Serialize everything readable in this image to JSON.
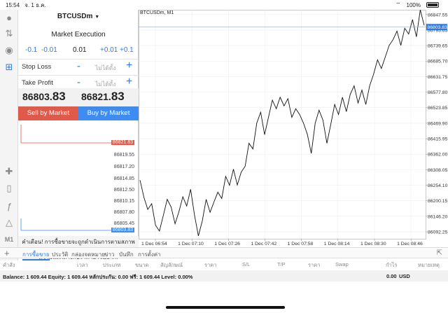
{
  "status_bar": {
    "time": "15:54",
    "date": "จ. 1 ธ.ค.",
    "battery": "100%"
  },
  "order": {
    "symbol": "BTCUSDm",
    "execution": "Market Execution",
    "volume": {
      "minus_01": "-0.1",
      "minus_001": "-0.01",
      "value": "0.01",
      "plus_001": "+0.01",
      "plus_01": "+0.1"
    },
    "stop_loss": {
      "label": "Stop Loss",
      "placeholder": "ไม่ได้ตั้ง",
      "minus": "-",
      "plus": "+"
    },
    "take_profit": {
      "label": "Take Profit",
      "placeholder": "ไม่ได้ตั้ง",
      "minus": "-",
      "plus": "+"
    },
    "sell_price": {
      "head": "86803.",
      "tail": "83"
    },
    "buy_price": {
      "head": "86821.",
      "tail": "83"
    },
    "sell_label": "Sell by Market",
    "buy_label": "Buy by Market",
    "ladder": {
      "ask_tag": "86821.83",
      "bid_tag": "86803.83",
      "ticks": [
        "86819.55",
        "86817.20",
        "86814.85",
        "86812.50",
        "86810.15",
        "86807.80",
        "86805.45"
      ]
    },
    "warning_line1": "คำเตือน! การซื้อขายจะถูกดำเนินการตามสภาพตลาด",
    "warning_line2": "ความแตกต่างกับราคาอาจมีมาก!"
  },
  "chart": {
    "title": "BTCUSDm, M1",
    "price_tag": "86803.83",
    "accent_color": "#2d7be5"
  },
  "chart_data": {
    "type": "line",
    "title": "BTCUSDm, M1",
    "y_ticks": [
      86847.55,
      86793.65,
      86739.65,
      86685.7,
      86631.75,
      86577.8,
      86523.85,
      86469.9,
      86415.95,
      86362.0,
      86308.05,
      86254.1,
      86200.15,
      86146.2,
      86092.25
    ],
    "x_ticks": [
      "1 Dec 06:54",
      "1 Dec 07:10",
      "1 Dec 07:26",
      "1 Dec 07:42",
      "1 Dec 07:58",
      "1 Dec 08:14",
      "1 Dec 08:30",
      "1 Dec 08:46"
    ],
    "ylim": [
      86068,
      86864
    ],
    "current_price": 86803.83,
    "values": [
      86272,
      86212,
      86170,
      86190,
      86115,
      86095,
      86150,
      86205,
      86178,
      86120,
      86162,
      86214,
      86182,
      86240,
      86150,
      86078,
      86130,
      86205,
      86160,
      86196,
      86230,
      86208,
      86285,
      86254,
      86310,
      86255,
      86300,
      86320,
      86400,
      86380,
      86470,
      86508,
      86430,
      86490,
      86550,
      86520,
      86560,
      86530,
      86555,
      86490,
      86520,
      86500,
      86470,
      86430,
      86365,
      86470,
      86515,
      86480,
      86400,
      86465,
      86535,
      86500,
      86560,
      86510,
      86570,
      86600,
      86540,
      86585,
      86535,
      86600,
      86640,
      86690,
      86660,
      86700,
      86740,
      86760,
      86790,
      86740,
      86800,
      86780,
      86830,
      86770,
      86864,
      86810
    ]
  },
  "bottom": {
    "tabs": [
      "การซื้อขาย",
      "ประวัติ",
      "กล่องจดหมาย",
      "ข่าว",
      "บันทึก",
      "การตั้งค่า"
    ],
    "columns": [
      "คำสั่ง",
      "เวลา",
      "ประเภท",
      "ขนาด",
      "สัญลักษณ์",
      "ราคา",
      "S/L",
      "T/P",
      "ราคา",
      "Swap",
      "กำไร",
      "หมายเหตุ"
    ],
    "balance_text": "Balance: 1 609.44 Equity: 1 609.44 หลักประกัน: 0.00 ฟรี: 1 609.44 Level: 0.00%",
    "profit": "0.00",
    "currency": "USD"
  }
}
